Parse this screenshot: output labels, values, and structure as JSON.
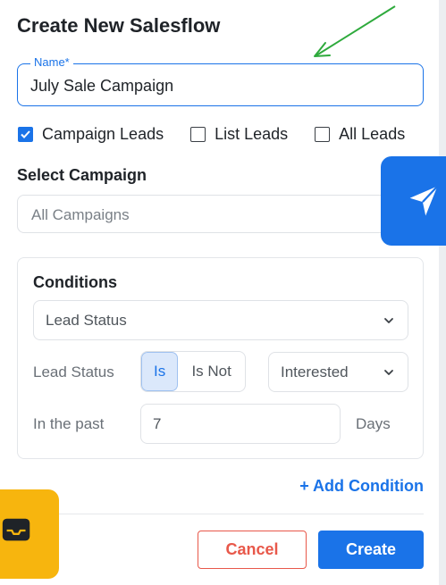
{
  "dialog": {
    "title": "Create New Salesflow"
  },
  "name_field": {
    "label": "Name*",
    "value": "July Sale Campaign"
  },
  "lead_types": [
    {
      "label": "Campaign Leads",
      "checked": true
    },
    {
      "label": "List Leads",
      "checked": false
    },
    {
      "label": "All Leads",
      "checked": false
    }
  ],
  "campaign": {
    "label": "Select Campaign",
    "value": "All Campaigns"
  },
  "conditions": {
    "title": "Conditions",
    "field_select": "Lead Status",
    "row1": {
      "label": "Lead Status",
      "options": [
        "Is",
        "Is Not"
      ],
      "selected": "Is",
      "value": "Interested"
    },
    "row2": {
      "label": "In the past",
      "value": "7",
      "unit": "Days"
    }
  },
  "add_condition": "+ Add Condition",
  "buttons": {
    "cancel": "Cancel",
    "create": "Create"
  },
  "icons": {
    "fab": "send-icon",
    "widget": "inbox-icon",
    "annotation": "green-arrow"
  },
  "colors": {
    "accent": "#1a73e8",
    "danger": "#e8584a",
    "widget": "#f7b50e",
    "annotation": "#2eaa3c"
  }
}
